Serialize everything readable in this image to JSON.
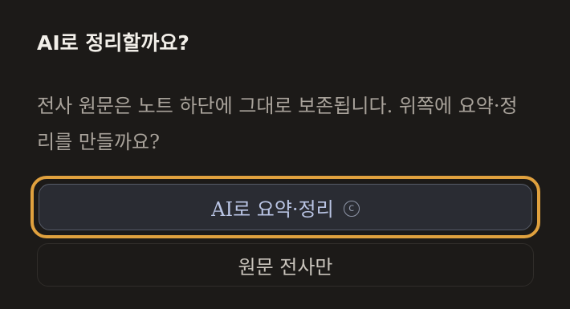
{
  "dialog": {
    "title": "AI로 정리할까요?",
    "message": "전사 원문은 노트 하단에 그대로 보존됩니다. 위쪽에 요약·정리를 만들까요?",
    "primary_button": {
      "label": "AI로 요약·정리",
      "badge": "c",
      "badge_icon": "copyright-icon"
    },
    "secondary_button": {
      "label": "원문 전사만"
    }
  },
  "colors": {
    "background": "#1c1a18",
    "focus_ring": "#e0a13e",
    "primary_fill": "#2a2c33",
    "primary_text": "#b9c4e4",
    "title_text": "#f2efe9",
    "body_text": "#a9a39b"
  }
}
